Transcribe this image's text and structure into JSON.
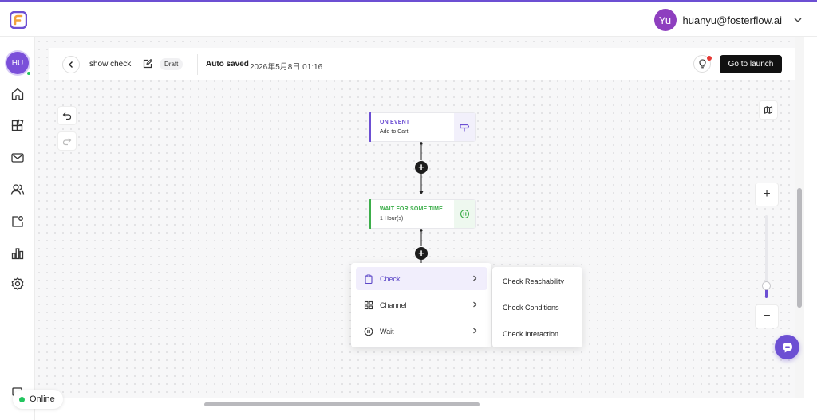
{
  "header": {
    "user_initials": "Yu",
    "user_email": "huanyu@fosterflow.ai"
  },
  "sidebar": {
    "avatar_initials": "HU",
    "items": [
      "home-icon",
      "grid-icon",
      "mail-icon",
      "users-icon",
      "segment-icon",
      "chart-icon",
      "settings-icon"
    ]
  },
  "flow": {
    "name": "show check",
    "status": "Draft",
    "saved_label": "Auto saved",
    "saved_time": "2026年5月8日 01:16",
    "launch_label": "Go to launch"
  },
  "nodes": [
    {
      "title": "ON EVENT",
      "subtitle": "Add to Cart",
      "color": "#6c4fd3",
      "icon": "signpost-icon"
    },
    {
      "title": "WAIT FOR SOME TIME",
      "subtitle": "1 Hour(s)",
      "color": "#3cae4a",
      "icon": "pause-circle-icon"
    }
  ],
  "menu": {
    "items": [
      {
        "label": "Check",
        "icon": "clipboard-icon",
        "active": true
      },
      {
        "label": "Channel",
        "icon": "grid-icon",
        "active": false
      },
      {
        "label": "Wait",
        "icon": "pause-circle-icon",
        "active": false
      }
    ],
    "submenu": [
      "Check Reachability",
      "Check Conditions",
      "Check Interaction"
    ]
  },
  "status": {
    "online_label": "Online"
  },
  "colors": {
    "accent": "#6c4fd3",
    "event": "#6c4fd3",
    "wait": "#3cae4a",
    "online": "#22c55e"
  }
}
